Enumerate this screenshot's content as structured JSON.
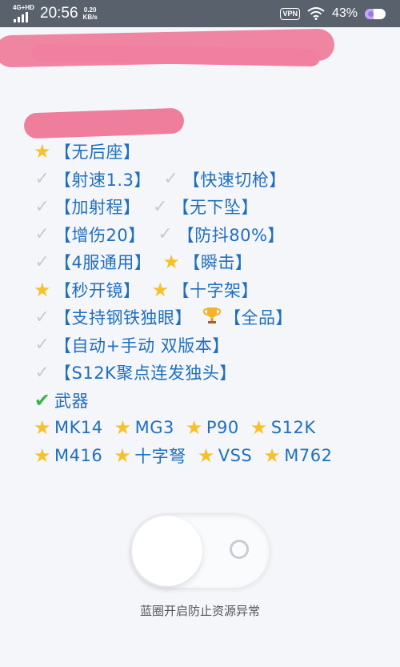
{
  "status_bar": {
    "network": "4G+HD",
    "time": "20:56",
    "speed_value": "0.20",
    "speed_unit": "KB/s",
    "vpn": "VPN",
    "battery": "43%"
  },
  "features": [
    [
      {
        "icon": "star",
        "text": "【无后座】"
      }
    ],
    [
      {
        "icon": "tick",
        "text": "【射速1.3】"
      },
      {
        "icon": "tick",
        "text": "【快速切枪】"
      }
    ],
    [
      {
        "icon": "tick",
        "text": "【加射程】"
      },
      {
        "icon": "tick",
        "text": "【无下坠】"
      }
    ],
    [
      {
        "icon": "tick",
        "text": "【增伤20】"
      },
      {
        "icon": "tick",
        "text": "【防抖80%】"
      }
    ],
    [
      {
        "icon": "tick",
        "text": "【4服通用】"
      },
      {
        "icon": "star",
        "text": "【瞬击】"
      }
    ],
    [
      {
        "icon": "star",
        "text": "【秒开镜】"
      },
      {
        "icon": "star",
        "text": "【十字架】"
      }
    ],
    [
      {
        "icon": "tick",
        "text": "【支持钢铁独眼】"
      },
      {
        "icon": "trophy",
        "text": "【全品】"
      }
    ],
    [
      {
        "icon": "tick",
        "text": "【自动+手动 双版本】"
      }
    ],
    [
      {
        "icon": "tick",
        "text": "【S12K聚点连发独头】"
      }
    ],
    [
      {
        "icon": "check",
        "text": "武器"
      }
    ],
    [
      {
        "icon": "star",
        "text": "MK14"
      },
      {
        "icon": "star",
        "text": "MG3"
      },
      {
        "icon": "star",
        "text": "P90"
      },
      {
        "icon": "star",
        "text": "S12K"
      }
    ],
    [
      {
        "icon": "star",
        "text": "M416"
      },
      {
        "icon": "star",
        "text": "十字弩"
      },
      {
        "icon": "star",
        "text": "VSS"
      },
      {
        "icon": "star",
        "text": "M762"
      }
    ]
  ],
  "toggle": {
    "on": false
  },
  "caption": "蓝圈开启防止资源异常",
  "colors": {
    "accent_text": "#1f6fc0",
    "status_bar": "#59626c",
    "redaction": "#ef7e9c"
  }
}
